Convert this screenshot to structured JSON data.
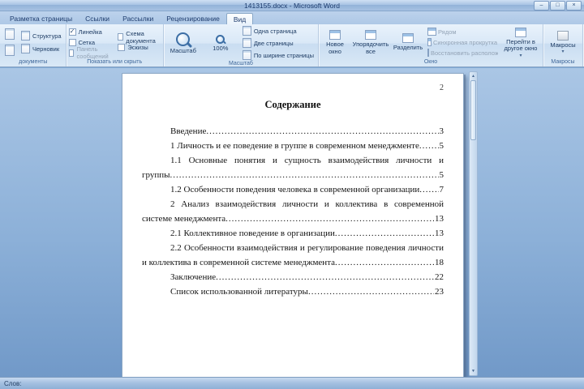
{
  "window": {
    "title": "1413155.docx - Microsoft Word",
    "controls": {
      "minimize": "–",
      "maximize": "□",
      "close": "×"
    }
  },
  "tabs": [
    {
      "label": "Разметка страницы"
    },
    {
      "label": "Ссылки"
    },
    {
      "label": "Рассылки"
    },
    {
      "label": "Рецензирование"
    },
    {
      "label": "Вид"
    }
  ],
  "ribbon": {
    "views_group": {
      "label": "документы",
      "items": [
        {
          "label": "Структура"
        },
        {
          "label": "Черновик"
        }
      ]
    },
    "show_group": {
      "label": "Показать или скрыть",
      "checkboxes": [
        {
          "label": "Линейка",
          "check": "✓"
        },
        {
          "label": "Сетка",
          "check": ""
        },
        {
          "label": "Панель сообщений",
          "check": ""
        },
        {
          "label": "Схема документа",
          "check": ""
        },
        {
          "label": "Эскизы",
          "check": ""
        }
      ]
    },
    "zoom_group": {
      "label": "Масштаб",
      "zoom_button": "Масштаб",
      "percent_button": "100%",
      "page_buttons": [
        {
          "label": "Одна страница"
        },
        {
          "label": "Две страницы"
        },
        {
          "label": "По ширине страницы"
        }
      ]
    },
    "window_group": {
      "label": "Окно",
      "main_buttons": [
        {
          "label": "Новое окно"
        },
        {
          "label": "Упорядочить все"
        },
        {
          "label": "Разделить"
        }
      ],
      "side_buttons": [
        {
          "label": "Рядом"
        },
        {
          "label": "Синхронная прокрутка"
        },
        {
          "label": "Восстановить расположение окна"
        }
      ],
      "switch_button": {
        "label": "Перейти в другое окно"
      }
    },
    "macros_group": {
      "label": "Макросы",
      "button": {
        "label": "Макросы"
      }
    }
  },
  "document": {
    "page_number": "2",
    "heading": "Содержание",
    "toc_lines": [
      {
        "text": "Введение",
        "page": "3"
      },
      {
        "text": "1 Личность и ее поведение в группе в современном менеджменте",
        "page": "5"
      },
      {
        "text": "1.1 Основные понятия и сущность взаимодействия личности и",
        "page": ""
      },
      {
        "text": "группы",
        "page": "5"
      },
      {
        "text": "1.2 Особенности поведения человека в современной организации",
        "page": "7"
      },
      {
        "text": "2 Анализ взаимодействия личности и коллектива в современной",
        "page": ""
      },
      {
        "text": "системе менеджмента",
        "page": "13"
      },
      {
        "text": "2.1 Коллективное поведение в организации",
        "page": "13"
      },
      {
        "text": "2.2 Особенности взаимодействия и регулирование поведения личности",
        "page": ""
      },
      {
        "text": "и коллектива в современной системе менеджмента",
        "page": "18"
      },
      {
        "text": "Заключение",
        "page": "22"
      },
      {
        "text": "Список использованной литературы",
        "page": "23"
      }
    ]
  },
  "status": {
    "left": "Слов:"
  }
}
